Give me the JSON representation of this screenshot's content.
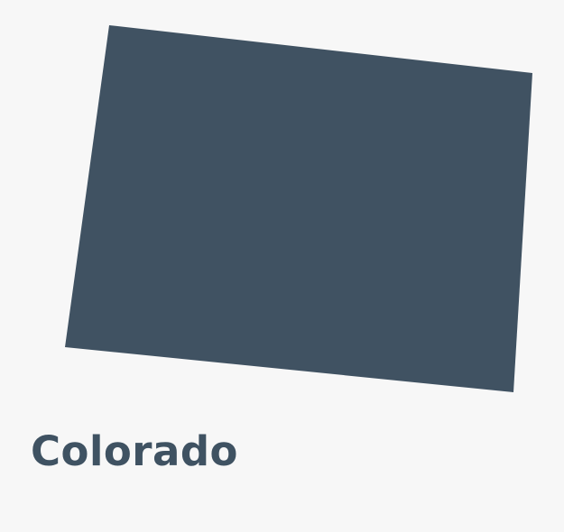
{
  "state": {
    "name": "Colorado",
    "fill_color": "#405262"
  },
  "colors": {
    "background": "#f7f7f7",
    "label": "#3f5262"
  }
}
